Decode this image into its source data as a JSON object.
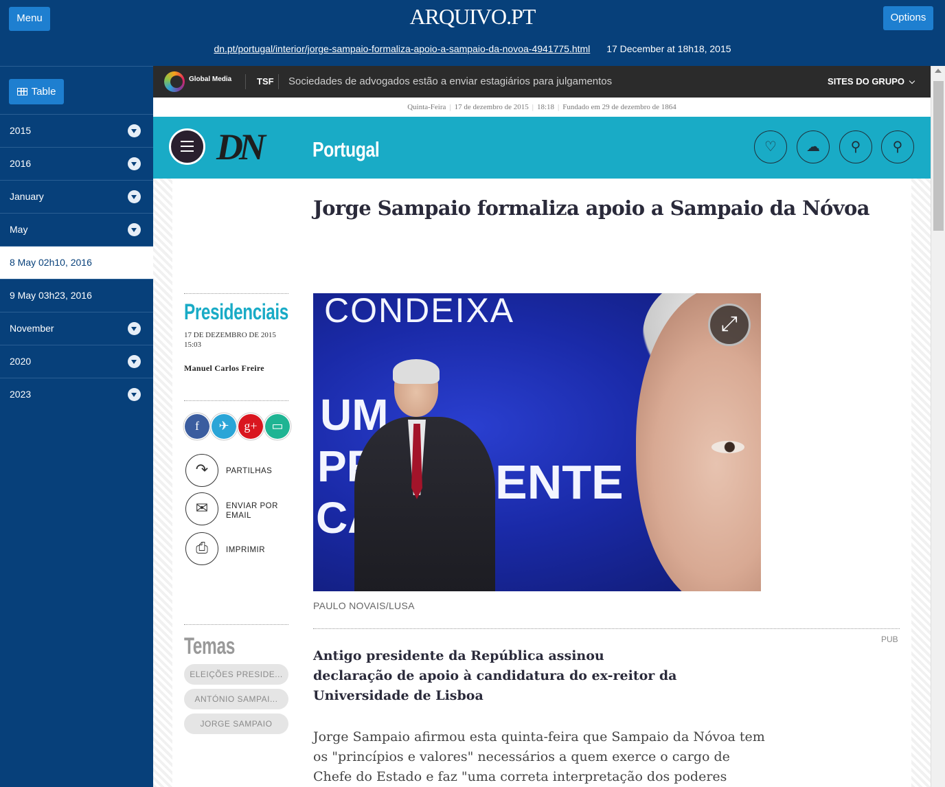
{
  "topbar": {
    "menu_label": "Menu",
    "options_label": "Options",
    "logo": "ARQUIVO.PT",
    "url": "dn.pt/portugal/interior/jorge-sampaio-formaliza-apoio-a-sampaio-da-novoa-4941775.html",
    "capture_date": "17 December at 18h18, 2015"
  },
  "sidebar": {
    "table_label": "Table",
    "items": [
      {
        "label": "2015",
        "expandable": true
      },
      {
        "label": "2016",
        "expandable": true
      },
      {
        "label": "January",
        "expandable": true
      },
      {
        "label": "May",
        "expandable": true
      },
      {
        "label": "8 May 02h10, 2016",
        "active": true
      },
      {
        "label": "9 May 03h23, 2016"
      },
      {
        "label": "November",
        "expandable": true
      },
      {
        "label": "2020",
        "expandable": true
      },
      {
        "label": "2023",
        "expandable": true
      }
    ]
  },
  "site": {
    "group_name": "Global Media",
    "tsf": "TSF",
    "headline_ticker": "Sociedades de advogados estão a enviar estagiários para julgamentos",
    "sites_label": "SITES DO GRUPO",
    "dateline": {
      "weekday": "Quinta-Feira",
      "date": "17 de dezembro de 2015",
      "time": "18:18",
      "founded": "Fundado em 29 de dezembro de 1864"
    },
    "logo": "DN",
    "section": "Portugal"
  },
  "article": {
    "title": "Jorge Sampaio formaliza apoio a Sampaio da Nóvoa",
    "category": "Presidenciais",
    "date": "17 DE DEZEMBRO DE 2015",
    "time": "15:03",
    "author": "Manuel Carlos Freire",
    "actions": {
      "share": "PARTILHAS",
      "email": "ENVIAR POR EMAIL",
      "print": "IMPRIMIR"
    },
    "temas_title": "Temas",
    "tags": [
      "ELEIÇÕES PRESIDE...",
      "ANTÓNIO SAMPAI...",
      "JORGE SAMPAIO"
    ],
    "photo": {
      "banner_top": "CONDEIXA",
      "banner_line1": "UM",
      "banner_line2": "PR",
      "banner_line2b": "ENTE",
      "banner_line3": "CA"
    },
    "photo_credit": "PAULO NOVAIS/LUSA",
    "pub": "PUB",
    "lead": "Antigo presidente da República assinou declaração de apoio à candidatura do ex-reitor da Universidade de Lisboa",
    "body": "Jorge Sampaio afirmou esta quinta-feira que Sampaio da Nóvoa tem os \"princípios e valores\" necessários a quem exerce o cargo de Chefe do Estado e faz \"uma correta interpretação dos poderes"
  },
  "colors": {
    "archive_blue": "#07407a",
    "button_blue": "#1e7fd0",
    "dn_teal": "#19abc6",
    "gm_bar": "#2b2b2b"
  }
}
